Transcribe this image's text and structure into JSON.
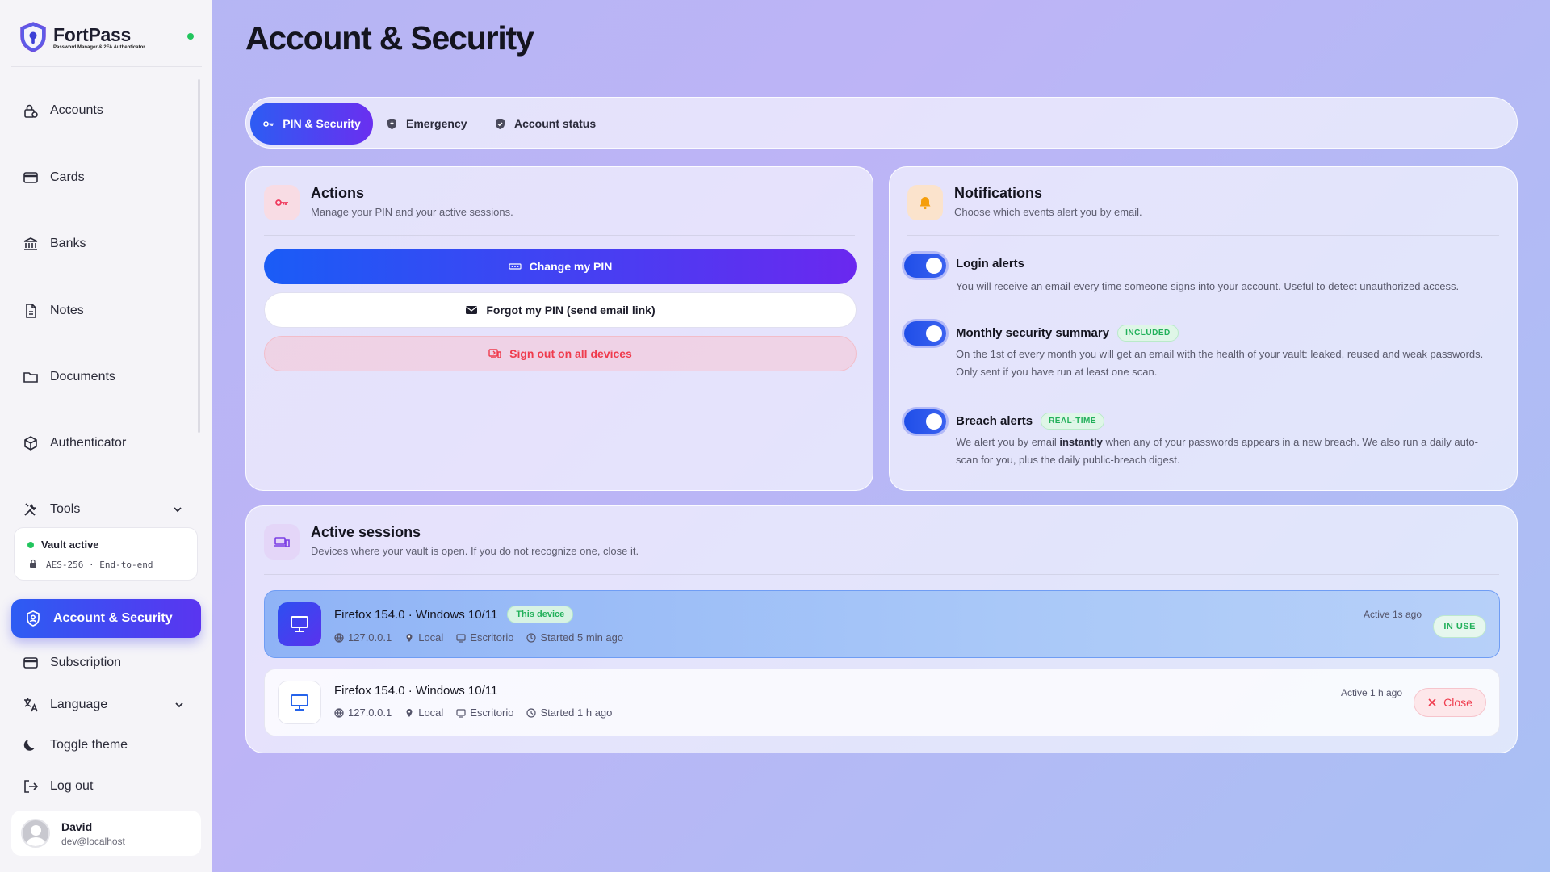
{
  "app": {
    "name": "FortPass",
    "tagline": "Password Manager & 2FA Authenticator"
  },
  "sidebar": {
    "items": [
      {
        "label": "Accounts",
        "icon": "lock-user-icon"
      },
      {
        "label": "Cards",
        "icon": "credit-card-icon"
      },
      {
        "label": "Banks",
        "icon": "bank-icon"
      },
      {
        "label": "Notes",
        "icon": "note-icon"
      },
      {
        "label": "Documents",
        "icon": "folder-icon"
      },
      {
        "label": "Authenticator",
        "icon": "cube-icon"
      },
      {
        "label": "Tools",
        "icon": "tools-icon"
      }
    ],
    "vault": {
      "title": "Vault active",
      "meta": "AES-256 · End-to-end"
    },
    "active_item": "Account & Security",
    "bottom_items": [
      {
        "label": "Subscription",
        "icon": "card-icon"
      },
      {
        "label": "Language",
        "icon": "translate-icon"
      },
      {
        "label": "Toggle theme",
        "icon": "moon-icon"
      },
      {
        "label": "Log out",
        "icon": "logout-icon"
      }
    ],
    "user": {
      "name": "David",
      "email": "dev@localhost"
    }
  },
  "page": {
    "title": "Account & Security"
  },
  "tabs": [
    {
      "label": "PIN & Security",
      "active": true
    },
    {
      "label": "Emergency",
      "active": false
    },
    {
      "label": "Account status",
      "active": false
    }
  ],
  "actions": {
    "title": "Actions",
    "subtitle": "Manage your PIN and your active sessions.",
    "change_pin": "Change my PIN",
    "forgot_pin": "Forgot my PIN (send email link)",
    "sign_out_all": "Sign out on all devices"
  },
  "notifications": {
    "title": "Notifications",
    "subtitle": "Choose which events alert you by email.",
    "items": [
      {
        "title": "Login alerts",
        "badge": "",
        "desc": "You will receive an email every time someone signs into your account. Useful to detect unauthorized access.",
        "enabled": true
      },
      {
        "title": "Monthly security summary",
        "badge": "INCLUDED",
        "desc": "On the 1st of every month you will get an email with the health of your vault: leaked, reused and weak passwords. Only sent if you have run at least one scan.",
        "enabled": true
      },
      {
        "title": "Breach alerts",
        "badge": "REAL-TIME",
        "desc_pre": "We alert you by email ",
        "desc_bold": "instantly",
        "desc_post": " when any of your passwords appears in a new breach. We also run a daily auto-scan for you, plus the daily public-breach digest.",
        "enabled": true
      }
    ]
  },
  "sessions": {
    "title": "Active sessions",
    "subtitle": "Devices where your vault is open. If you do not recognize one, close it.",
    "items": [
      {
        "device": "Firefox 154.0 · Windows 10/11",
        "this_device": "This device",
        "ip": "127.0.0.1",
        "location": "Local",
        "type": "Escritorio",
        "started": "Started 5 min ago",
        "active": "Active 1s ago",
        "status": "IN USE"
      },
      {
        "device": "Firefox 154.0 · Windows 10/11",
        "ip": "127.0.0.1",
        "location": "Local",
        "type": "Escritorio",
        "started": "Started 1 h ago",
        "active": "Active 1 h ago",
        "action": "Close"
      }
    ]
  },
  "colors": {
    "accent": "#2d5cf3",
    "accent2": "#6a28ef",
    "danger": "#ef3b4d",
    "success": "#22c55e"
  }
}
